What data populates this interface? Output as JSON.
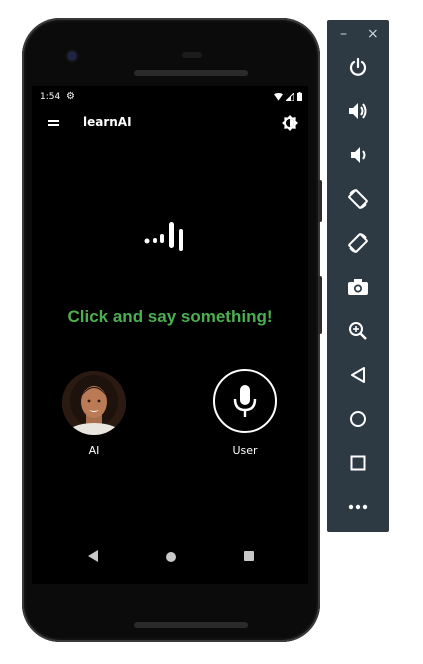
{
  "status_bar": {
    "time": "1:54"
  },
  "app_bar": {
    "title": "learnAI"
  },
  "main": {
    "prompt": "Click and say something!",
    "ai_label": "AI",
    "user_label": "User"
  },
  "colors": {
    "accent_green": "#4caf50",
    "toolbar_bg": "#2d3943",
    "screen_bg": "#000000"
  },
  "emulator_toolbar": {
    "minimize": "–",
    "close": "×",
    "buttons": [
      "power-icon",
      "volume-up-icon",
      "volume-down-icon",
      "rotate-left-icon",
      "rotate-right-icon",
      "camera-icon",
      "zoom-icon",
      "back-icon",
      "home-icon",
      "overview-icon",
      "more-icon"
    ]
  }
}
